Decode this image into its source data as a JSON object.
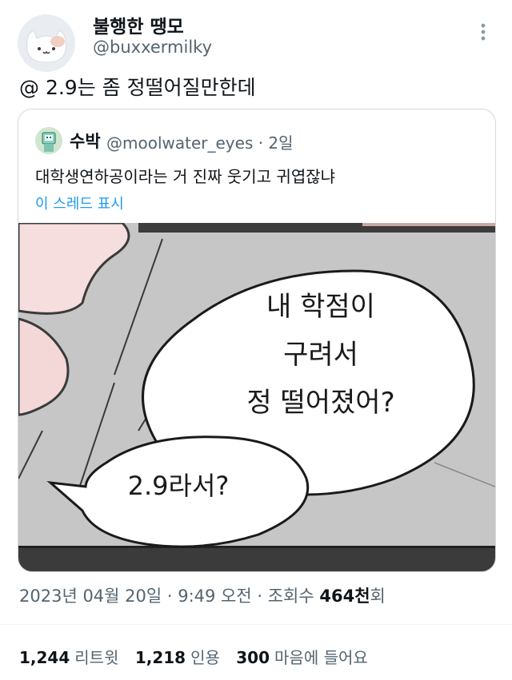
{
  "author": {
    "name": "불행한 땡모",
    "handle": "@buxxermilky"
  },
  "tweet": {
    "text": "@ 2.9는 좀 정떨어질만한데"
  },
  "quote": {
    "name": "수박",
    "handle_time": "@moolwater_eyes · 2일",
    "text": "대학생연하공이라는 거 진짜 웃기고 귀엽잖냐",
    "thread_link": "이 스레드 표시",
    "comic": {
      "bubble_large": [
        "내 학점이",
        "구려서",
        "정 떨어졌어?"
      ],
      "bubble_small": "2.9라서?"
    }
  },
  "meta": {
    "date_time": "2023년 04월 20일 · 9:49 오전 · 조회수 ",
    "views": "464천",
    "views_suffix": "회"
  },
  "stats": {
    "retweets": "1,244",
    "retweets_label": "리트윗",
    "quotes": "1,218",
    "quotes_label": "인용",
    "likes": "300",
    "likes_label": "마음에 들어요"
  },
  "colors": {
    "text": "#0f1419",
    "secondary": "#536471",
    "link": "#1d9bf0",
    "border": "#cfd9de"
  }
}
